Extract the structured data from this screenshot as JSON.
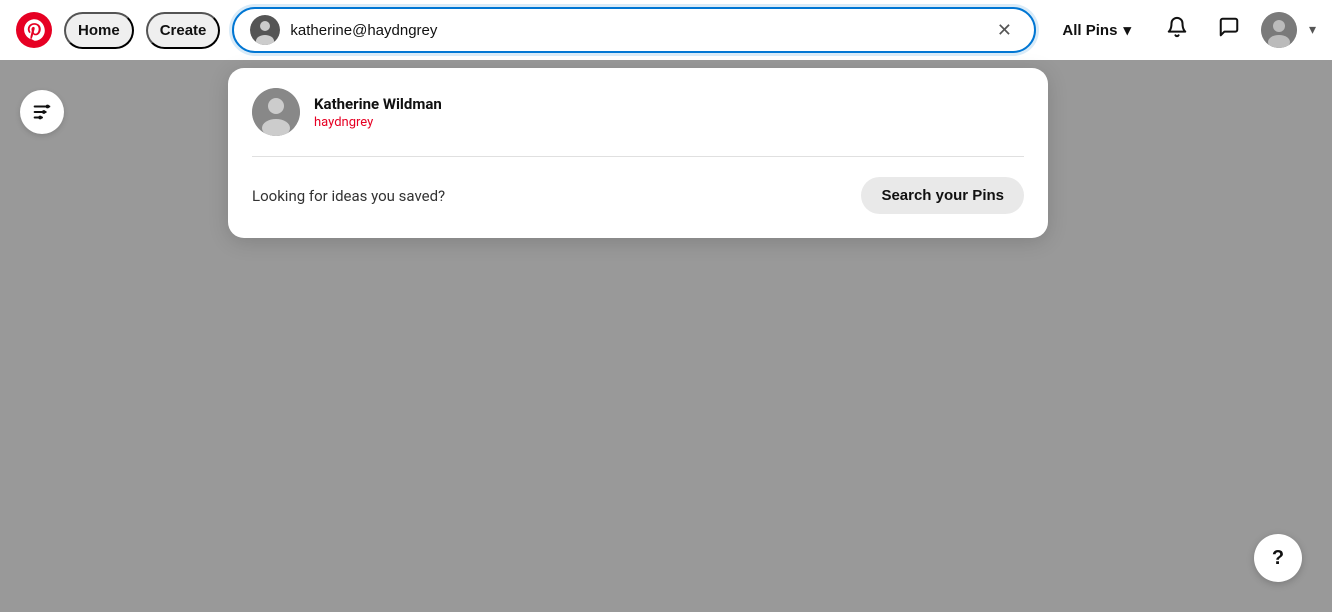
{
  "nav": {
    "home_label": "Home",
    "create_label": "Create",
    "all_pins_label": "All Pins",
    "search_value": "katherine@haydngrey"
  },
  "dropdown": {
    "user_name": "Katherine Wildman",
    "user_username": "haydngrey",
    "looking_text": "Looking for ideas you saved?",
    "search_pins_label": "Search your Pins"
  },
  "icons": {
    "clear": "✕",
    "chevron_down": "▾",
    "bell": "🔔",
    "message": "💬",
    "filter": "⊟",
    "help": "?"
  }
}
